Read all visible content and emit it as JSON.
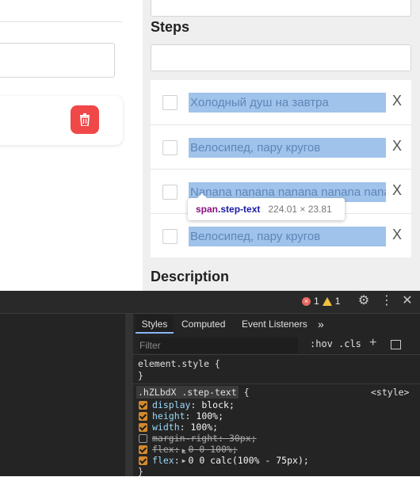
{
  "steps_section": {
    "title": "Steps",
    "items": [
      {
        "text": "Холодный душ на завтра",
        "checked": false,
        "remove_label": "X"
      },
      {
        "text": "Велосипед, пару кругов",
        "checked": false,
        "remove_label": "X"
      },
      {
        "text": "Nanana nanana nanana nanana nanana",
        "checked": false,
        "remove_label": "X"
      },
      {
        "text": "Велосипед, пару кругов",
        "checked": false,
        "remove_label": "X"
      }
    ]
  },
  "tooltip": {
    "tag": "span",
    "class_name": ".step-text",
    "dimensions": "224.01 × 23.81"
  },
  "description_section": {
    "title": "Description"
  },
  "left_panel": {
    "delete_icon": "trash-icon",
    "delete_color": "#f04848"
  },
  "devtools": {
    "errors": "1",
    "warnings": "1",
    "tabs": [
      "Styles",
      "Computed",
      "Event Listeners"
    ],
    "more_tabs": "»",
    "filter_placeholder": "Filter",
    "hov_label": ":hov",
    "cls_label": ".cls",
    "element_style": {
      "selector": "element.style {",
      "close": "}"
    },
    "rule": {
      "selector": ".hZLbdX .step-text",
      "open": "{",
      "source": "<style>",
      "close": "}",
      "properties": [
        {
          "name": "display",
          "value": "block;",
          "enabled": true,
          "overridden": false
        },
        {
          "name": "height",
          "value": "100%;",
          "enabled": true,
          "overridden": false
        },
        {
          "name": "width",
          "value": "100%;",
          "enabled": true,
          "overridden": false
        },
        {
          "name": "margin-right",
          "value": "30px;",
          "enabled": false,
          "overridden": true
        },
        {
          "name": "flex",
          "value": "0 0 100%;",
          "enabled": true,
          "overridden": true
        },
        {
          "name": "flex",
          "value": "0 0 calc(100% - 75px);",
          "enabled": true,
          "overridden": false
        }
      ]
    }
  }
}
